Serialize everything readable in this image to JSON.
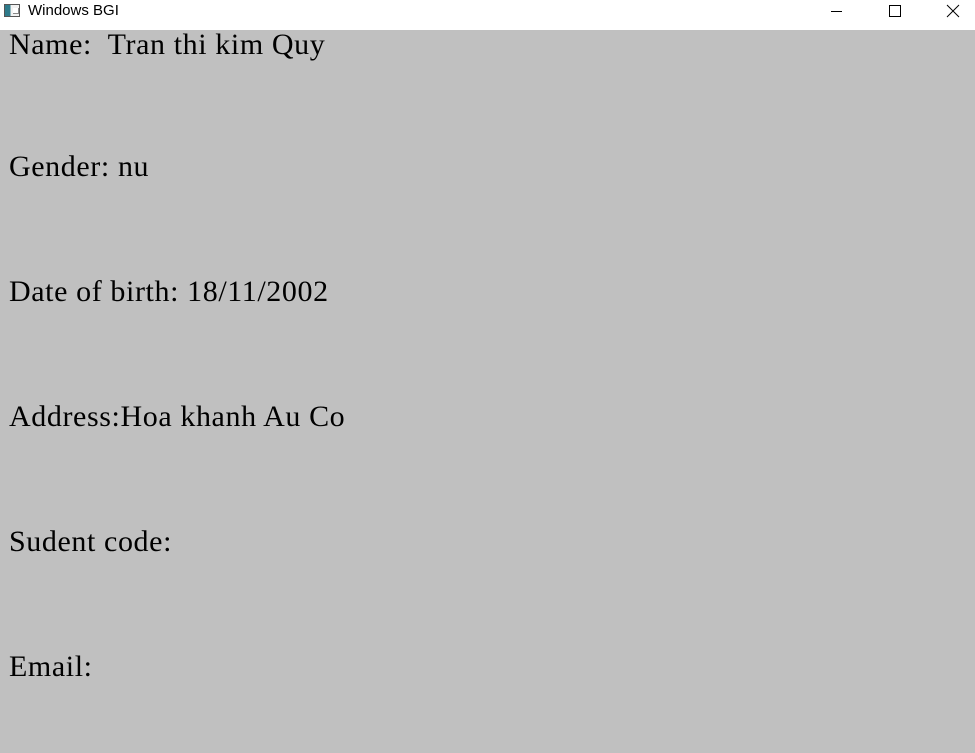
{
  "window": {
    "title": "Windows BGI",
    "icon": "bgi-window-icon",
    "controls": {
      "minimize_icon": "minimize-icon",
      "maximize_icon": "maximize-icon",
      "close_icon": "close-icon"
    }
  },
  "colors": {
    "client_background": "#c0c0c0",
    "text": "#000000",
    "titlebar_background": "#ffffff"
  },
  "fields": [
    {
      "label": "Name:",
      "value": "Tran thi kim Quy",
      "separator": "  "
    },
    {
      "label": "Gender:",
      "value": "nu",
      "separator": " "
    },
    {
      "label": "Date of birth:",
      "value": "18/11/2002",
      "separator": " "
    },
    {
      "label": "Address:",
      "value": "Hoa khanh Au Co",
      "separator": ""
    },
    {
      "label": "Sudent code:",
      "value": "",
      "separator": ""
    },
    {
      "label": "Email:",
      "value": "",
      "separator": ""
    }
  ]
}
